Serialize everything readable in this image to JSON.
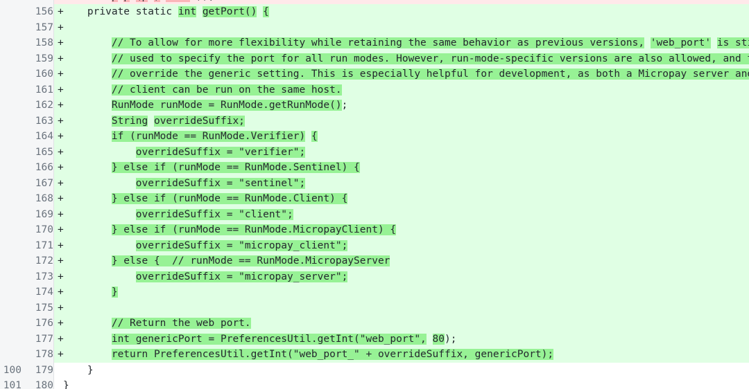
{
  "view": {
    "kind": "unified-diff",
    "language": "java",
    "colors": {
      "add_line_bg": "#e0ffe4",
      "add_word_bg": "#97f295",
      "del_line_bg": "#ffe9ea",
      "del_word_bg": "#fbb6b9",
      "context_bg": "#ffffff",
      "gutter_bg": "#f5f6f7",
      "gutter_border": "#dfe2e5",
      "line_number_fg": "#6a737d",
      "code_fg": "#24292e"
    }
  },
  "rows": [
    {
      "type": "del",
      "old_no": "",
      "new_no": "",
      "marker": "-",
      "clipped": "top",
      "segments": [
        {
          "text": "        ",
          "hl": false
        },
        {
          "text": "p",
          "hl": true
        },
        {
          "text": " ",
          "hl": false
        },
        {
          "text": "p",
          "hl": true
        },
        {
          "text": " ",
          "hl": false
        },
        {
          "text": "(p",
          "hl": true
        },
        {
          "text": " ",
          "hl": false
        },
        {
          "text": ")",
          "hl": true
        },
        {
          "text": " ",
          "hl": false
        },
        {
          "text": "    ",
          "hl": true
        },
        {
          "text": " ",
          "hl": false
        },
        {
          "text": "));",
          "hl": false
        }
      ]
    },
    {
      "type": "add",
      "old_no": "",
      "new_no": "156",
      "marker": "+",
      "segments": [
        {
          "text": "    private static ",
          "hl": false
        },
        {
          "text": "int",
          "hl": true
        },
        {
          "text": " ",
          "hl": false
        },
        {
          "text": "getPort()",
          "hl": true
        },
        {
          "text": " ",
          "hl": false
        },
        {
          "text": "{",
          "hl": true
        }
      ]
    },
    {
      "type": "add",
      "old_no": "",
      "new_no": "157",
      "marker": "+",
      "segments": [
        {
          "text": "",
          "hl": false
        }
      ]
    },
    {
      "type": "add",
      "old_no": "",
      "new_no": "158",
      "marker": "+",
      "segments": [
        {
          "text": "        ",
          "hl": false
        },
        {
          "text": "// To allow for more flexibility while retaining the same behavior as previous versions,",
          "hl": true
        },
        {
          "text": " ",
          "hl": false
        },
        {
          "text": "'web_port'",
          "hl": true
        },
        {
          "text": " ",
          "hl": false
        },
        {
          "text": "is still",
          "hl": true
        }
      ]
    },
    {
      "type": "add",
      "old_no": "",
      "new_no": "159",
      "marker": "+",
      "segments": [
        {
          "text": "        ",
          "hl": false
        },
        {
          "text": "// used to specify the port for all run modes. However, run-mode-specific versions are also allowed, and they",
          "hl": true
        }
      ]
    },
    {
      "type": "add",
      "old_no": "",
      "new_no": "160",
      "marker": "+",
      "segments": [
        {
          "text": "        ",
          "hl": false
        },
        {
          "text": "// override the generic setting. This is especially helpful for development, as both a Micropay server and",
          "hl": true
        }
      ]
    },
    {
      "type": "add",
      "old_no": "",
      "new_no": "161",
      "marker": "+",
      "segments": [
        {
          "text": "        ",
          "hl": false
        },
        {
          "text": "// client can be run on the same host.",
          "hl": true
        }
      ]
    },
    {
      "type": "add",
      "old_no": "",
      "new_no": "162",
      "marker": "+",
      "segments": [
        {
          "text": "        ",
          "hl": false
        },
        {
          "text": "RunMode runMode = RunMode.getRunMode()",
          "hl": true
        },
        {
          "text": ";",
          "hl": false
        }
      ]
    },
    {
      "type": "add",
      "old_no": "",
      "new_no": "163",
      "marker": "+",
      "segments": [
        {
          "text": "        ",
          "hl": false
        },
        {
          "text": "String",
          "hl": true
        },
        {
          "text": " ",
          "hl": false
        },
        {
          "text": "overrideSuffix;",
          "hl": true
        }
      ]
    },
    {
      "type": "add",
      "old_no": "",
      "new_no": "164",
      "marker": "+",
      "segments": [
        {
          "text": "        ",
          "hl": false
        },
        {
          "text": "if (runMode == RunMode.Verifier)",
          "hl": true
        },
        {
          "text": " ",
          "hl": false
        },
        {
          "text": "{",
          "hl": true
        }
      ]
    },
    {
      "type": "add",
      "old_no": "",
      "new_no": "165",
      "marker": "+",
      "segments": [
        {
          "text": "            ",
          "hl": false
        },
        {
          "text": "overrideSuffix = \"verifier\";",
          "hl": true
        }
      ]
    },
    {
      "type": "add",
      "old_no": "",
      "new_no": "166",
      "marker": "+",
      "segments": [
        {
          "text": "        ",
          "hl": false
        },
        {
          "text": "} else if (runMode == RunMode",
          "hl": true
        },
        {
          "text": "",
          "hl": false
        },
        {
          "text": ".Sentinel) {",
          "hl": true
        }
      ]
    },
    {
      "type": "add",
      "old_no": "",
      "new_no": "167",
      "marker": "+",
      "segments": [
        {
          "text": "            ",
          "hl": false
        },
        {
          "text": "overrideSuffix = \"sentinel\";",
          "hl": true
        }
      ]
    },
    {
      "type": "add",
      "old_no": "",
      "new_no": "168",
      "marker": "+",
      "segments": [
        {
          "text": "        ",
          "hl": false
        },
        {
          "text": "} else if ",
          "hl": true
        },
        {
          "text": "",
          "hl": false
        },
        {
          "text": "(runMode == RunMode.Client) {",
          "hl": true
        }
      ]
    },
    {
      "type": "add",
      "old_no": "",
      "new_no": "169",
      "marker": "+",
      "segments": [
        {
          "text": "            ",
          "hl": false
        },
        {
          "text": "overrideSuffix = \"client\";",
          "hl": true
        }
      ]
    },
    {
      "type": "add",
      "old_no": "",
      "new_no": "170",
      "marker": "+",
      "segments": [
        {
          "text": "        ",
          "hl": false
        },
        {
          "text": "} else if (runMode == RunMode.MicropayClient) {",
          "hl": true
        }
      ]
    },
    {
      "type": "add",
      "old_no": "",
      "new_no": "171",
      "marker": "+",
      "segments": [
        {
          "text": "            ",
          "hl": false
        },
        {
          "text": "overrideSuffix = \"micropay_client\";",
          "hl": true
        }
      ]
    },
    {
      "type": "add",
      "old_no": "",
      "new_no": "172",
      "marker": "+",
      "segments": [
        {
          "text": "        ",
          "hl": false
        },
        {
          "text": "} else {  // runMode == RunMode.MicropayServer",
          "hl": true
        }
      ]
    },
    {
      "type": "add",
      "old_no": "",
      "new_no": "173",
      "marker": "+",
      "segments": [
        {
          "text": "            ",
          "hl": false
        },
        {
          "text": "overrideSuffix = \"micropay_server\";",
          "hl": true
        }
      ]
    },
    {
      "type": "add",
      "old_no": "",
      "new_no": "174",
      "marker": "+",
      "segments": [
        {
          "text": "        ",
          "hl": false
        },
        {
          "text": "}",
          "hl": true
        }
      ]
    },
    {
      "type": "add",
      "old_no": "",
      "new_no": "175",
      "marker": "+",
      "segments": [
        {
          "text": "",
          "hl": false
        }
      ]
    },
    {
      "type": "add",
      "old_no": "",
      "new_no": "176",
      "marker": "+",
      "segments": [
        {
          "text": "        ",
          "hl": false
        },
        {
          "text": "// Return the web port.",
          "hl": true
        }
      ]
    },
    {
      "type": "add",
      "old_no": "",
      "new_no": "177",
      "marker": "+",
      "segments": [
        {
          "text": "        ",
          "hl": false
        },
        {
          "text": "int genericPort = PreferencesUtil.getInt(\"web_port\",",
          "hl": true
        },
        {
          "text": " ",
          "hl": false
        },
        {
          "text": "80",
          "hl": true
        },
        {
          "text": ");",
          "hl": false
        }
      ]
    },
    {
      "type": "add",
      "old_no": "",
      "new_no": "178",
      "marker": "+",
      "segments": [
        {
          "text": "        ",
          "hl": false
        },
        {
          "text": "return PreferencesUtil.getInt(\"web_port_\" + overrideSuffix, genericPort);",
          "hl": true
        }
      ]
    },
    {
      "type": "ctx",
      "old_no": "100",
      "new_no": "179",
      "marker": " ",
      "segments": [
        {
          "text": "    }",
          "hl": false
        }
      ]
    },
    {
      "type": "ctx",
      "old_no": "101",
      "new_no": "180",
      "marker": " ",
      "clipped": "bottom",
      "segments": [
        {
          "text": "}",
          "hl": false
        }
      ]
    }
  ]
}
